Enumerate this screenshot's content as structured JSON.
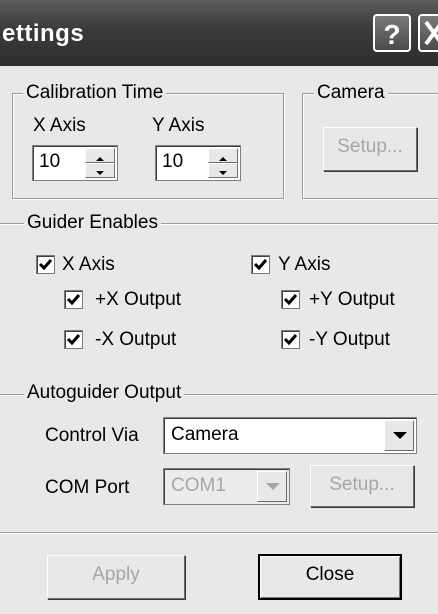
{
  "window": {
    "title": "ettings"
  },
  "titlebar": {
    "help_label": "?",
    "close_label": "X"
  },
  "calibration": {
    "legend": "Calibration Time",
    "x_label": "X Axis",
    "y_label": "Y Axis",
    "x_value": "10",
    "y_value": "10"
  },
  "camera": {
    "legend": "Camera",
    "setup_label": "Setup..."
  },
  "guider": {
    "legend": "Guider Enables",
    "x_axis": {
      "label": "X Axis",
      "checked": true
    },
    "y_axis": {
      "label": "Y Axis",
      "checked": true
    },
    "plus_x": {
      "label": "+X Output",
      "checked": true
    },
    "plus_y": {
      "label": "+Y Output",
      "checked": true
    },
    "minus_x": {
      "label": "-X Output",
      "checked": true
    },
    "minus_y": {
      "label": "-Y Output",
      "checked": true
    }
  },
  "autoguider": {
    "legend": "Autoguider Output",
    "control_via_label": "Control Via",
    "control_via_value": "Camera",
    "com_port_label": "COM Port",
    "com_port_value": "COM1",
    "setup_label": "Setup..."
  },
  "footer": {
    "apply_label": "Apply",
    "close_label": "Close"
  },
  "colors": {
    "titlebar": "#3a3a3a",
    "dialog_bg": "#e8e8e8",
    "disabled_text": "#a6a6a6"
  }
}
